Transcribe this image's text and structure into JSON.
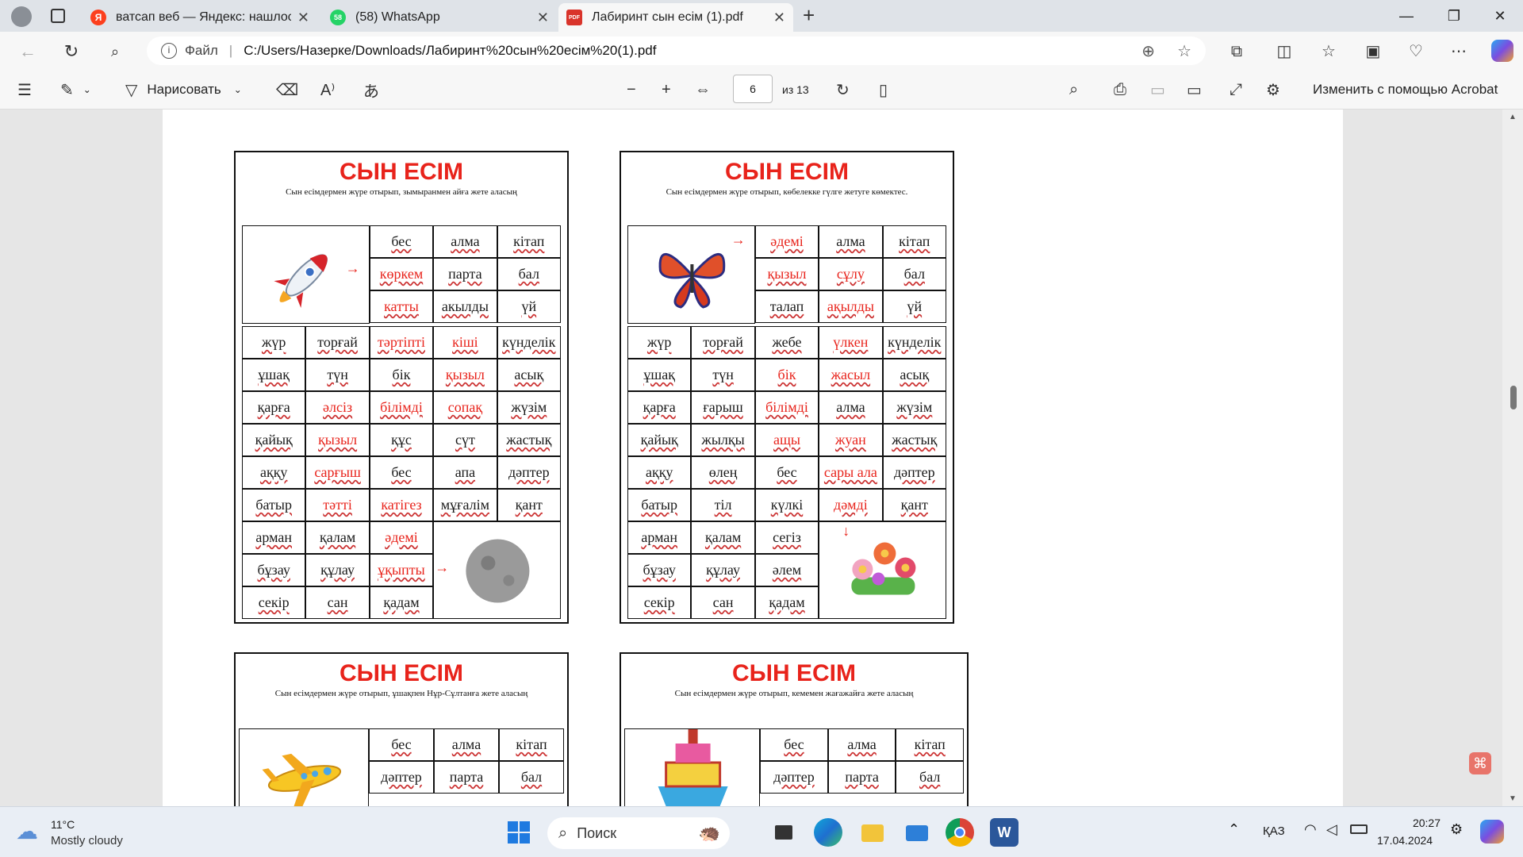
{
  "tabs": [
    {
      "title": "ватсап веб — Яндекс: нашлось",
      "icon": "yandex-icon",
      "color": "#fc3f1d",
      "glyph": "Я"
    },
    {
      "title": "(58) WhatsApp",
      "icon": "whatsapp-icon",
      "color": "#25d366",
      "glyph": "58"
    },
    {
      "title": "Лабиринт сын есім (1).pdf",
      "icon": "pdf-icon",
      "color": "#d9342b",
      "glyph": "PDF"
    }
  ],
  "address": {
    "file_label": "Файл",
    "url": "C:/Users/Назерке/Downloads/Лабиринт%20сын%20есім%20(1).pdf"
  },
  "pdf_toolbar": {
    "draw_label": "Нарисовать",
    "page_value": "6",
    "page_total": "из 13",
    "acrobat_label": "Изменить с помощью Acrobat"
  },
  "worksheets": [
    {
      "title": "СЫН ЕСІМ",
      "subtitle": "Сын есімдермен жүре отырып, зымыранмен айға жете аласың",
      "start": "rocket",
      "goal": "moon",
      "top_rows": [
        [
          "бес",
          "алма",
          "кітап"
        ],
        [
          "көркем",
          "парта",
          "бал"
        ],
        [
          "катты",
          "акылды",
          "үй"
        ]
      ],
      "top_red": [
        [
          false,
          false,
          false
        ],
        [
          true,
          false,
          false
        ],
        [
          true,
          false,
          false
        ]
      ],
      "mid_rows": [
        [
          "жүр",
          "торғай",
          "тәртіпті",
          "кіші",
          "күнделік"
        ],
        [
          "ұшақ",
          "түн",
          "бік",
          "қызыл",
          "асық"
        ],
        [
          "қарға",
          "әлсіз",
          "білімді",
          "сопақ",
          "жүзім"
        ],
        [
          "қайық",
          "қызыл",
          "құс",
          "сүт",
          "жастық"
        ],
        [
          "аққу",
          "сарғыш",
          "бес",
          "апа",
          "дәптер"
        ],
        [
          "батыр",
          "тәтті",
          "катігез",
          "мұғалім",
          "қант"
        ]
      ],
      "mid_red": [
        [
          false,
          false,
          true,
          true,
          false
        ],
        [
          false,
          false,
          false,
          true,
          false
        ],
        [
          false,
          true,
          true,
          true,
          false
        ],
        [
          false,
          true,
          false,
          false,
          false
        ],
        [
          false,
          true,
          false,
          false,
          false
        ],
        [
          false,
          true,
          true,
          false,
          false
        ]
      ],
      "bot_rows": [
        [
          "арман",
          "қалам",
          "әдемі"
        ],
        [
          "бұзау",
          "құлау",
          "ұқыпты"
        ],
        [
          "секір",
          "сан",
          "қадам"
        ]
      ],
      "bot_red": [
        [
          false,
          false,
          true
        ],
        [
          false,
          false,
          true
        ],
        [
          false,
          false,
          false
        ]
      ]
    },
    {
      "title": "СЫН ЕСІМ",
      "subtitle": "Сын есімдермен жүре отырып, көбелекке гүлге жетуге көмектес.",
      "start": "butterfly",
      "goal": "flowers",
      "top_rows": [
        [
          "әдемі",
          "алма",
          "кітап"
        ],
        [
          "қызыл",
          "сұлу",
          "бал"
        ],
        [
          "талап",
          "ақылды",
          "үй"
        ]
      ],
      "top_red": [
        [
          true,
          false,
          false
        ],
        [
          true,
          true,
          false
        ],
        [
          false,
          true,
          false
        ]
      ],
      "mid_rows": [
        [
          "жүр",
          "торғай",
          "жебе",
          "үлкен",
          "күнделік"
        ],
        [
          "ұшақ",
          "түн",
          "бік",
          "жасыл",
          "асық"
        ],
        [
          "қарға",
          "ғарыш",
          "білімді",
          "алма",
          "жүзім"
        ],
        [
          "қайық",
          "жылқы",
          "ащы",
          "жуан",
          "жастық"
        ],
        [
          "аққу",
          "өлең",
          "бес",
          "сары ала",
          "дәптер"
        ],
        [
          "батыр",
          "тіл",
          "күлкі",
          "дәмді",
          "қант"
        ]
      ],
      "mid_red": [
        [
          false,
          false,
          false,
          true,
          false
        ],
        [
          false,
          false,
          true,
          true,
          false
        ],
        [
          false,
          false,
          true,
          false,
          false
        ],
        [
          false,
          false,
          true,
          true,
          false
        ],
        [
          false,
          false,
          false,
          true,
          false
        ],
        [
          false,
          false,
          false,
          true,
          false
        ]
      ],
      "bot_rows": [
        [
          "арман",
          "қалам",
          "сегіз"
        ],
        [
          "бұзау",
          "құлау",
          "әлем"
        ],
        [
          "секір",
          "сан",
          "қадам"
        ]
      ],
      "bot_red": [
        [
          false,
          false,
          false
        ],
        [
          false,
          false,
          false
        ],
        [
          false,
          false,
          false
        ]
      ]
    },
    {
      "title": "СЫН ЕСІМ",
      "subtitle": "Сын есімдермен жүре отырып, ұшақпен Нұр-Сұлтанға жете аласың",
      "start": "airplane",
      "top_rows": [
        [
          "бес",
          "алма",
          "кітап"
        ],
        [
          "дәптер",
          "парта",
          "бал"
        ]
      ]
    },
    {
      "title": "СЫН ЕСІМ",
      "subtitle": "Сын есімдермен жүре отырып, кемемен жағажайға жете аласың",
      "start": "ship",
      "top_rows": [
        [
          "бес",
          "алма",
          "кітап"
        ],
        [
          "дәптер",
          "парта",
          "бал"
        ]
      ]
    }
  ],
  "taskbar": {
    "weather_temp": "11°C",
    "weather_text": "Mostly cloudy",
    "search_placeholder": "Поиск",
    "lang": "ҚАЗ",
    "time": "20:27",
    "date": "17.04.2024"
  }
}
